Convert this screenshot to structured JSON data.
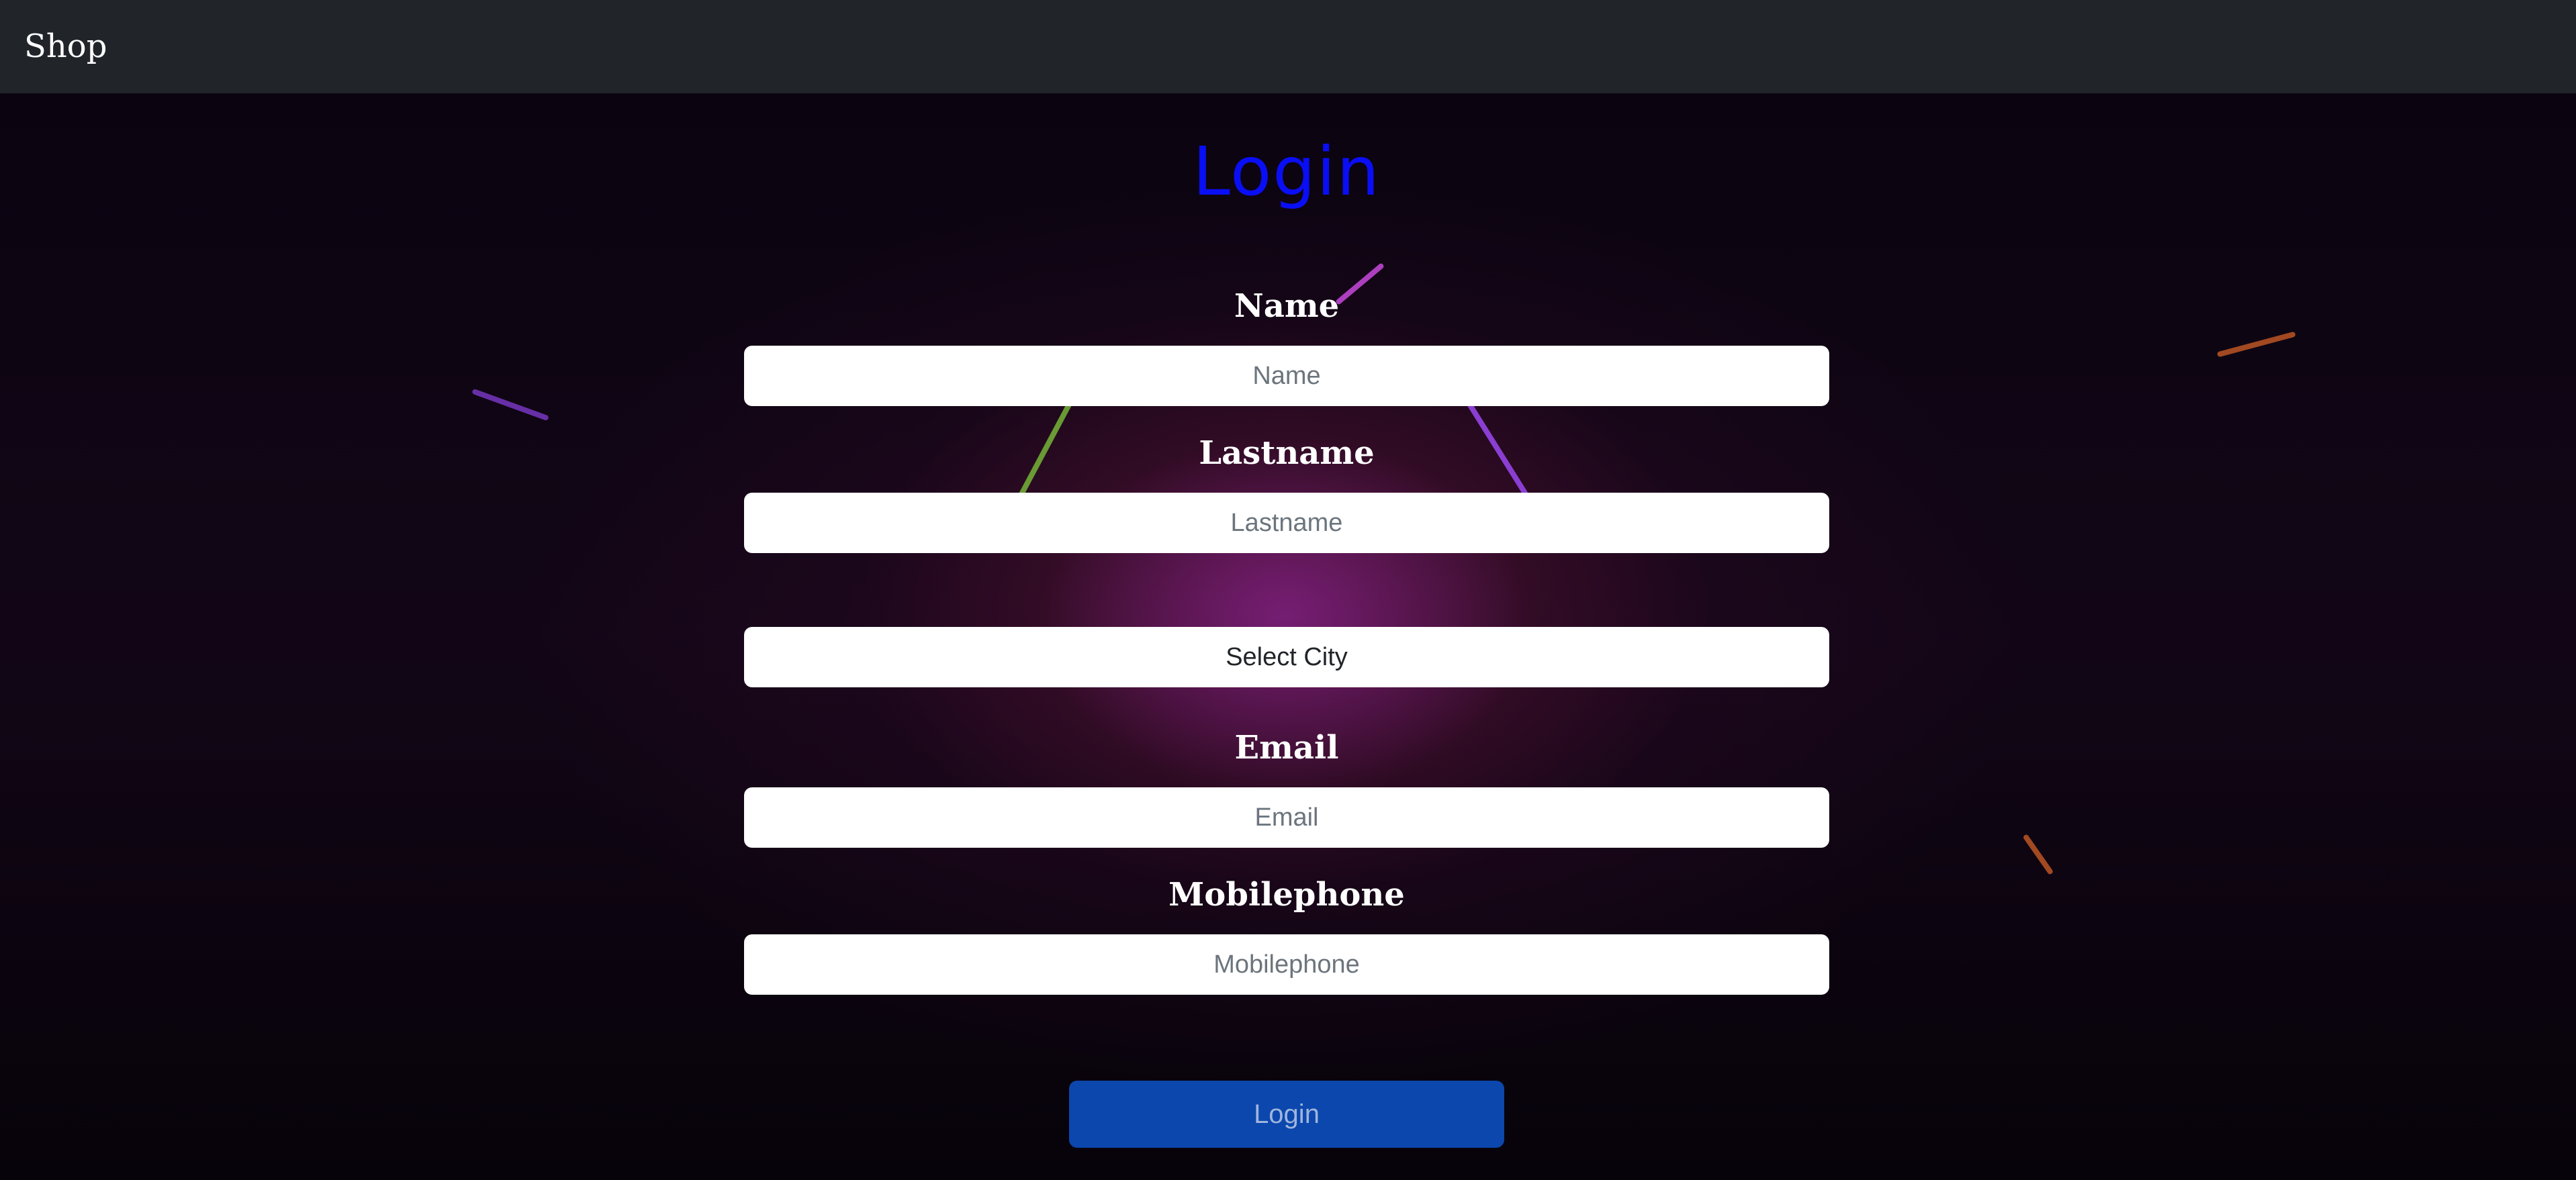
{
  "navbar": {
    "brand": "Shop"
  },
  "form": {
    "title": "Login",
    "name_label": "Name",
    "name_placeholder": "Name",
    "lastname_label": "Lastname",
    "lastname_placeholder": "Lastname",
    "city_select": "Select City",
    "email_label": "Email",
    "email_placeholder": "Email",
    "mobile_label": "Mobilephone",
    "mobile_placeholder": "Mobilephone",
    "submit_label": "Login"
  },
  "colors": {
    "navbar": "#212529",
    "title": "#0a0ef5",
    "button": "#0b47ad"
  }
}
